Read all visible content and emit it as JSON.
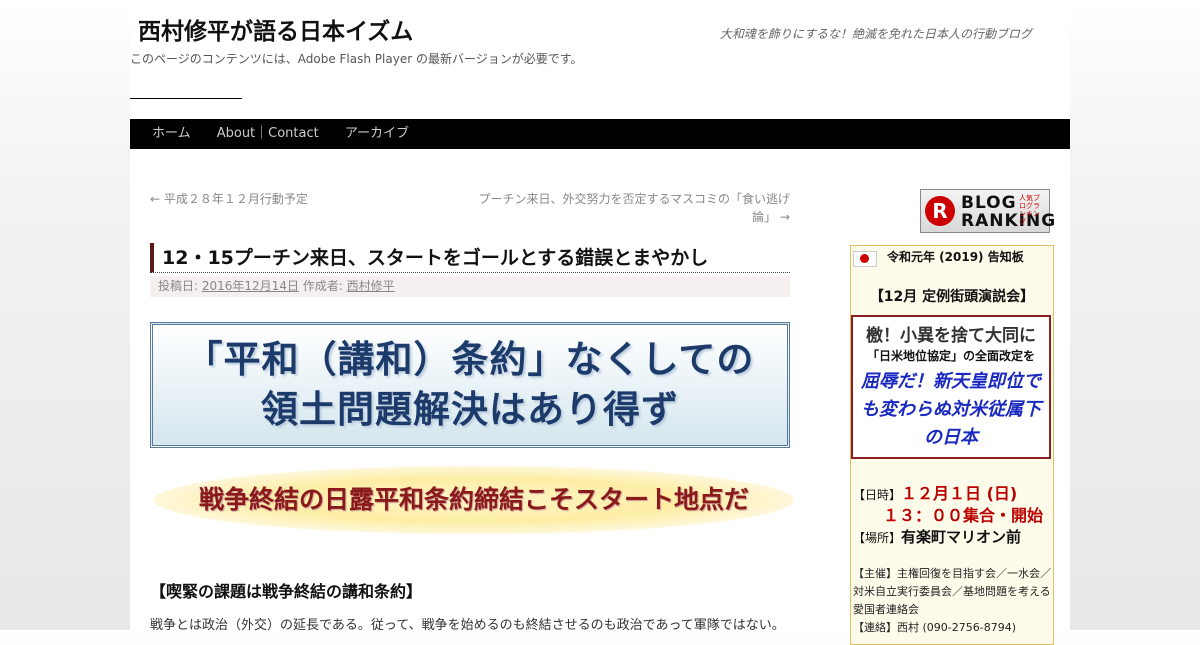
{
  "site": {
    "title": "西村修平が語る日本イズム",
    "tagline": "大和魂を飾りにするな！絶滅を免れた日本人の行動ブログ",
    "flash_note": "このページのコンテンツには、Adobe Flash Player の最新バージョンが必要です。"
  },
  "nav": {
    "items": [
      "ホーム",
      "About｜Contact",
      "アーカイブ"
    ]
  },
  "post_nav": {
    "prev": "← 平成２８年１２月行動予定",
    "next_line1": "プーチン来日、外交努力を否定するマスコミの「食い逃げ",
    "next_line2": "論」 →"
  },
  "post": {
    "title": "12・15プーチン来日、スタートをゴールとする錯誤とまやかし",
    "meta": {
      "posted_label": "投稿日:",
      "date": "2016年12月14日",
      "author_label": "作成者:",
      "author": "西村修平"
    },
    "banner1_line1": "「平和（講和）条約」なくしての",
    "banner1_line2": "領土問題解決はあり得ず",
    "banner2": "戦争終結の日露平和条約締結こそスタート地点だ",
    "section_heading": "【喫緊の課題は戦争終結の講和条約】",
    "body_text": "戦争とは政治（外交）の延長である。従って、戦争を始めるのも終結させるのも政治であって軍隊ではない。"
  },
  "sidebar": {
    "ranking": {
      "logo_letter": "R",
      "line1": "BLOG",
      "line2": "RANKING",
      "small": "人気ブログランキング"
    },
    "notice": {
      "title": "令和元年 (2019) 告知板",
      "event_heading": "【12月 定例街頭演説会】",
      "slogan1": "檄！小異を捨て大同に",
      "slogan2": "「日米地位協定」の全面改定を",
      "slogan3": "屈辱だ！新天皇即位でも変わらぬ対米従属下の日本",
      "date_label": "【日時】",
      "date_value": "１２月１日 (日)",
      "time_value": "１３：００集合・開始",
      "place_label": "【場所】",
      "place_value": "有楽町マリオン前",
      "organizer": "【主催】主権回復を目指す会／一水会／対米自立実行委員会／基地問題を考える愛国者連絡会",
      "contact": "【連絡】西村 (090-2756-8794)"
    }
  },
  "colors": {
    "nav_bg": "#000000",
    "title_accent": "#5b1a1a",
    "banner_text": "#1c3a6a",
    "banner2_text": "#8a1a1a",
    "slogan_blue": "#1a2ac0",
    "alert_red": "#bb0000"
  }
}
